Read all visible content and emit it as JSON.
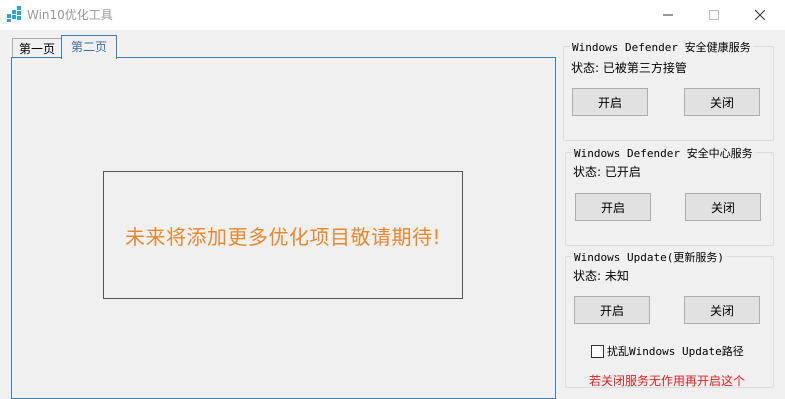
{
  "window": {
    "title": "Win10优化工具",
    "app_icon": "app-icon",
    "controls": [
      "minimize-icon",
      "maximize-icon",
      "close-icon"
    ]
  },
  "tabs": [
    {
      "label": "第一页",
      "selected": false
    },
    {
      "label": "第二页",
      "selected": true
    }
  ],
  "main": {
    "notice": "未来将添加更多优化项目敬请期待!"
  },
  "groups": [
    {
      "title": "Windows Defender 安全健康服务",
      "status": "状态: 已被第三方接管",
      "on_label": "开启",
      "off_label": "关闭"
    },
    {
      "title": "Windows Defender 安全中心服务",
      "status": "状态: 已开启",
      "on_label": "开启",
      "off_label": "关闭"
    },
    {
      "title": "Windows Update(更新服务)",
      "status": "状态: 未知",
      "on_label": "开启",
      "off_label": "关闭"
    }
  ],
  "update_options": {
    "disrupt_path_label": "扰乱Windows Update路径",
    "disrupt_path_checked": false,
    "warning": "若关闭服务无作用再开启这个"
  },
  "colors": {
    "notice": "#e8882c",
    "warning": "#e02020",
    "tab_accent": "#3c7fb1"
  }
}
